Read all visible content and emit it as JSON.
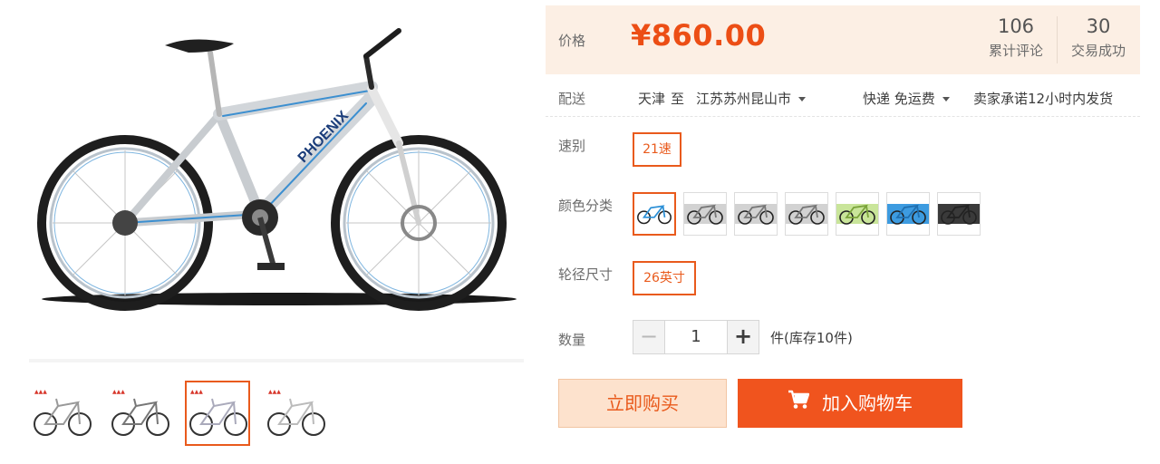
{
  "price": {
    "label": "价格",
    "value": "¥860.00",
    "currency": "¥",
    "amount": 860.0
  },
  "stats": [
    {
      "number": "106",
      "label": "累计评论"
    },
    {
      "number": "30",
      "label": "交易成功"
    }
  ],
  "delivery": {
    "label": "配送",
    "from": "天津",
    "to_word": "至",
    "destination": "江苏苏州昆山市",
    "method": "快递 免运费",
    "promise": "卖家承诺12小时内发货"
  },
  "speed": {
    "label": "速别",
    "selected": "21速"
  },
  "color": {
    "label": "颜色分类",
    "options": [
      {
        "icon": "bike-silver-blue-icon",
        "frame": "#2a8fd6",
        "bg": "#ffffff"
      },
      {
        "icon": "bike-grey-icon",
        "frame": "#777777",
        "bg": "#d2d2d2"
      },
      {
        "icon": "bike-grey-icon",
        "frame": "#777777",
        "bg": "#d2d2d2"
      },
      {
        "icon": "bike-grey-icon",
        "frame": "#777777",
        "bg": "#d2d2d2"
      },
      {
        "icon": "bike-green-icon",
        "frame": "#7aa33a",
        "bg": "#c9e59a"
      },
      {
        "icon": "bike-blue-icon",
        "frame": "#1f6fb0",
        "bg": "#3d9be0"
      },
      {
        "icon": "bike-black-icon",
        "frame": "#222222",
        "bg": "#3a3a3a"
      }
    ],
    "selected_index": 0
  },
  "wheel": {
    "label": "轮径尺寸",
    "selected": "26英寸"
  },
  "quantity": {
    "label": "数量",
    "value": "1",
    "minus": "−",
    "plus": "+",
    "stock": "件(库存10件)"
  },
  "actions": {
    "buy_now": "立即购买",
    "add_to_cart": "加入购物车"
  },
  "gallery": {
    "main_brand": "PHOENIX",
    "thumbnails": [
      {
        "icon": "bike-thumbnail-icon"
      },
      {
        "icon": "bike-thumbnail-icon"
      },
      {
        "icon": "bike-thumbnail-icon"
      },
      {
        "icon": "bike-thumbnail-icon"
      }
    ],
    "selected_index": 2
  },
  "colors": {
    "accent": "#e95a1c",
    "price": "#ec4e15",
    "price_panel_bg": "#fcefe4",
    "cart_button": "#f0541e",
    "buy_button_bg": "#fde2cd"
  }
}
